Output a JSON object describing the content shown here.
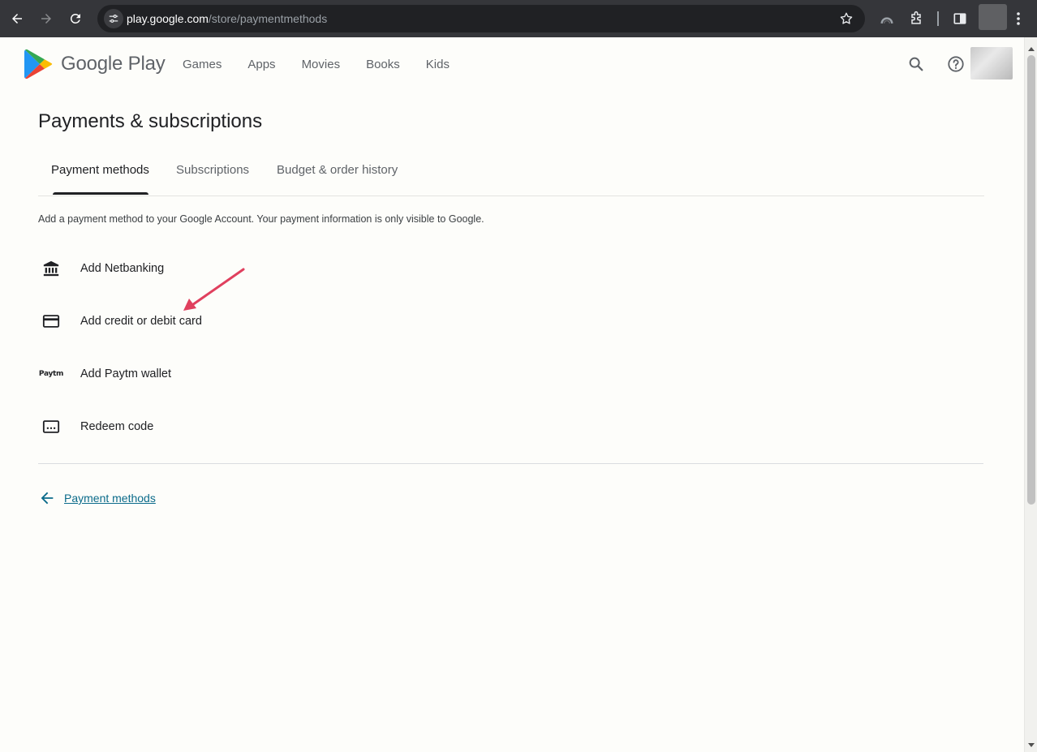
{
  "browser": {
    "url_host": "play.google.com",
    "url_path": "/store/paymentmethods"
  },
  "header": {
    "brand": "Google Play",
    "nav": [
      "Games",
      "Apps",
      "Movies",
      "Books",
      "Kids"
    ]
  },
  "main": {
    "title": "Payments & subscriptions",
    "tabs": [
      {
        "label": "Payment methods",
        "active": true
      },
      {
        "label": "Subscriptions",
        "active": false
      },
      {
        "label": "Budget & order history",
        "active": false
      }
    ],
    "description": "Add a payment method to your Google Account. Your payment information is only visible to Google.",
    "options": [
      {
        "label": "Add Netbanking",
        "icon": "bank-icon"
      },
      {
        "label": "Add credit or debit card",
        "icon": "credit-card-icon"
      },
      {
        "label": "Add Paytm wallet",
        "icon": "paytm-icon",
        "icon_text": "Paytm"
      },
      {
        "label": "Redeem code",
        "icon": "redeem-code-icon"
      }
    ],
    "back_link": "Payment methods"
  },
  "colors": {
    "chrome_bar": "#35363a",
    "omnibox": "#202124",
    "page_bg": "#fdfdfa",
    "link": "#0b6b8a",
    "annotation_arrow": "#e0405e"
  }
}
